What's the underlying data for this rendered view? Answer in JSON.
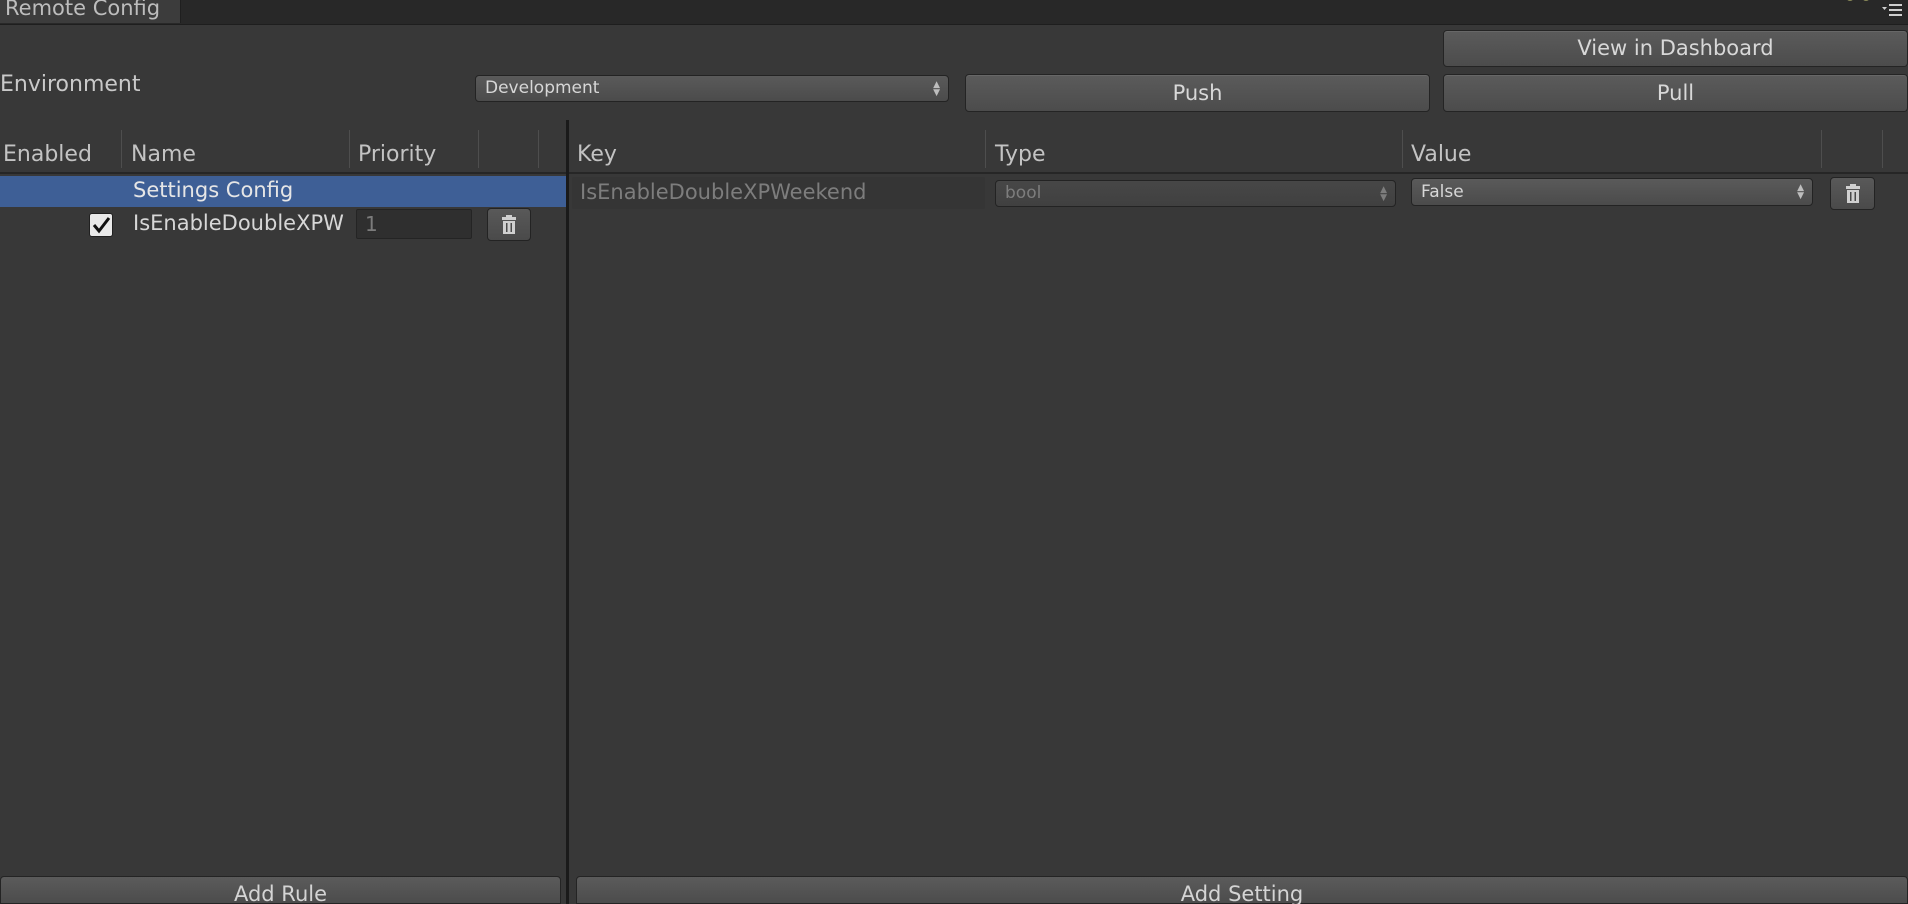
{
  "window": {
    "tab_title": "Remote Config",
    "menu_icon": "tab-menu-icon"
  },
  "toolbar": {
    "environment_label": "Environment",
    "environment_value": "Development",
    "dashboard_label": "View in Dashboard",
    "push_label": "Push",
    "pull_label": "Pull"
  },
  "rules_panel": {
    "columns": [
      "Enabled",
      "Name",
      "Priority"
    ],
    "settings_config_label": "Settings Config",
    "rows": [
      {
        "enabled": true,
        "name": "IsEnableDoubleXPW",
        "priority": "1"
      }
    ],
    "add_rule_label": "Add Rule"
  },
  "settings_panel": {
    "columns": [
      "Key",
      "Type",
      "Value"
    ],
    "rows": [
      {
        "key": "IsEnableDoubleXPWeekend",
        "type": "bool",
        "value": "False"
      }
    ],
    "add_setting_label": "Add Setting"
  },
  "colors": {
    "background": "#383838",
    "selection": "#3e5f96",
    "tab_strip": "#282828"
  }
}
